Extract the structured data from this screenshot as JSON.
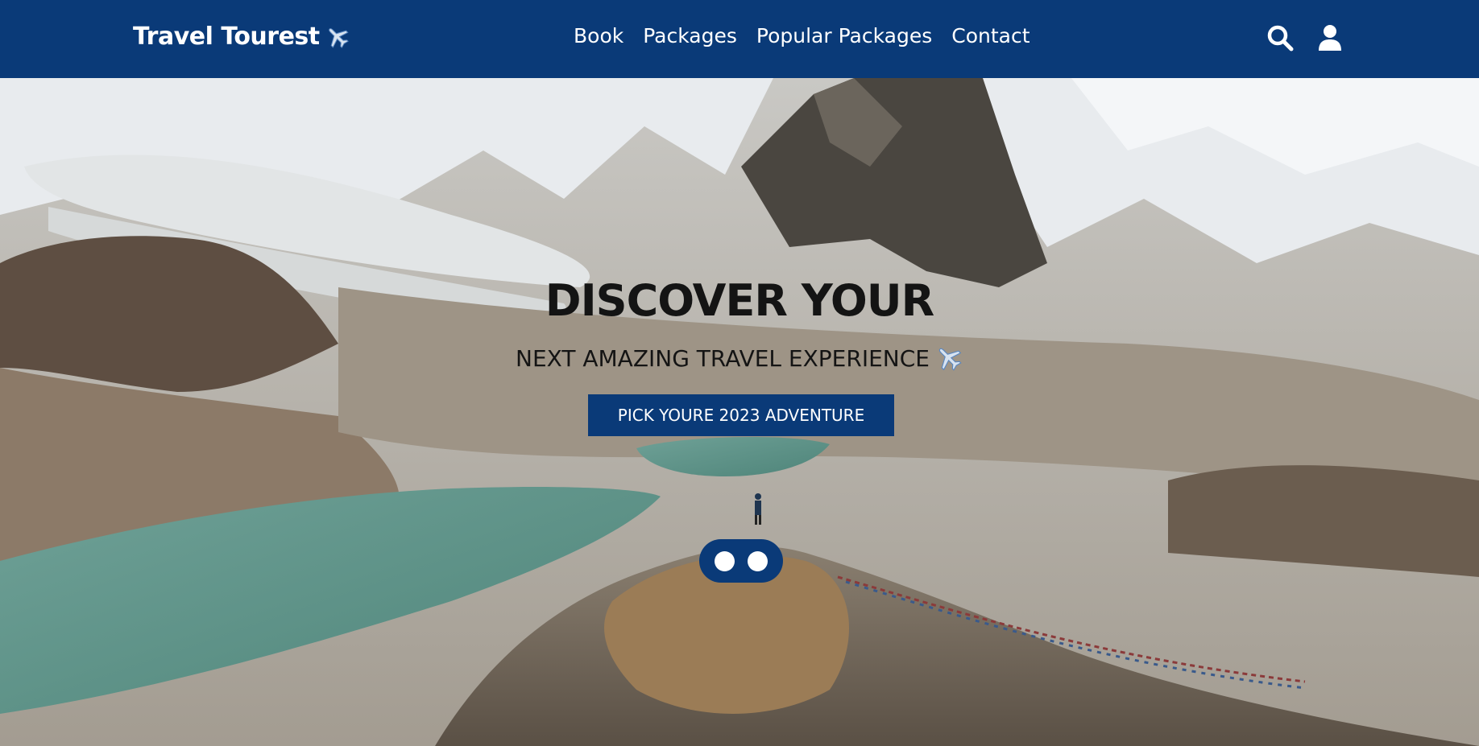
{
  "header": {
    "logo_text": "Travel Tourest",
    "logo_icon": "airplane-icon",
    "nav": [
      {
        "label": "Book"
      },
      {
        "label": "Packages"
      },
      {
        "label": "Popular Packages"
      },
      {
        "label": "Contact"
      }
    ],
    "icons": [
      "search-icon",
      "user-icon"
    ]
  },
  "hero": {
    "title": "DISCOVER YOUR",
    "subtitle": "NEXT AMAZING TRAVEL EXPERIENCE",
    "subtitle_icon": "airplane-icon",
    "cta_label": "PICK YOURE 2023 ADVENTURE",
    "slider_dot_count": 2,
    "background": "mountain-landscape-with-glacier-and-lakes"
  },
  "colors": {
    "brand": "#0a3a78",
    "text_light": "#ffffff",
    "hero_text": "#141414"
  }
}
